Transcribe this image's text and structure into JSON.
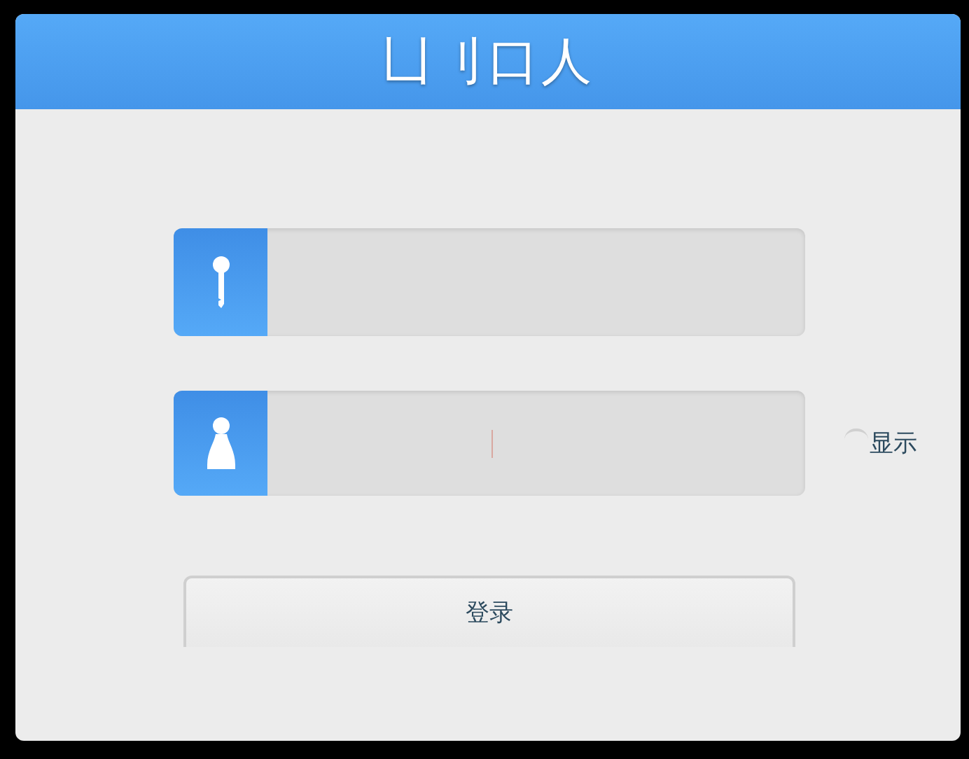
{
  "window": {
    "title": "凵刂口人"
  },
  "fields": [
    {
      "kind": "key",
      "focused": false
    },
    {
      "kind": "person",
      "focused": true
    }
  ],
  "show_toggle": {
    "label": "显示",
    "checked": false
  },
  "login_button": {
    "label": "登录"
  }
}
